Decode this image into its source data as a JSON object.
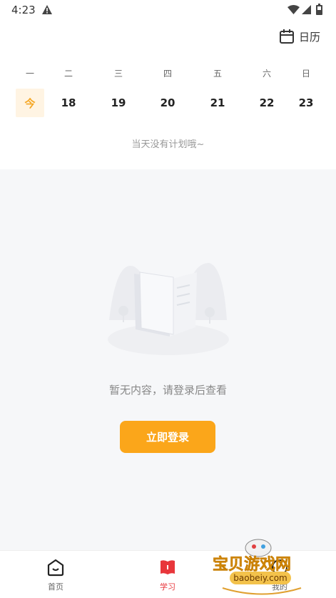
{
  "status_bar": {
    "time": "4:23"
  },
  "header": {
    "calendar_label": "日历"
  },
  "week": {
    "days": [
      "一",
      "二",
      "三",
      "四",
      "五",
      "六",
      "日"
    ],
    "dates": [
      "今",
      "18",
      "19",
      "20",
      "21",
      "22",
      "23"
    ]
  },
  "no_plan_text": "当天没有计划哦~",
  "empty_state": {
    "text": "暂无内容，请登录后查看",
    "login_button": "立即登录"
  },
  "bottom_nav": {
    "items": [
      {
        "label": "首页"
      },
      {
        "label": "学习"
      },
      {
        "label": "我的"
      }
    ]
  },
  "watermark": {
    "title": "宝贝游戏网",
    "url": "baobeiy.com"
  },
  "colors": {
    "accent": "#fba61a",
    "today_bg": "#fff4e3",
    "active_nav": "#e8363b",
    "empty_bg": "#f6f7f9"
  }
}
